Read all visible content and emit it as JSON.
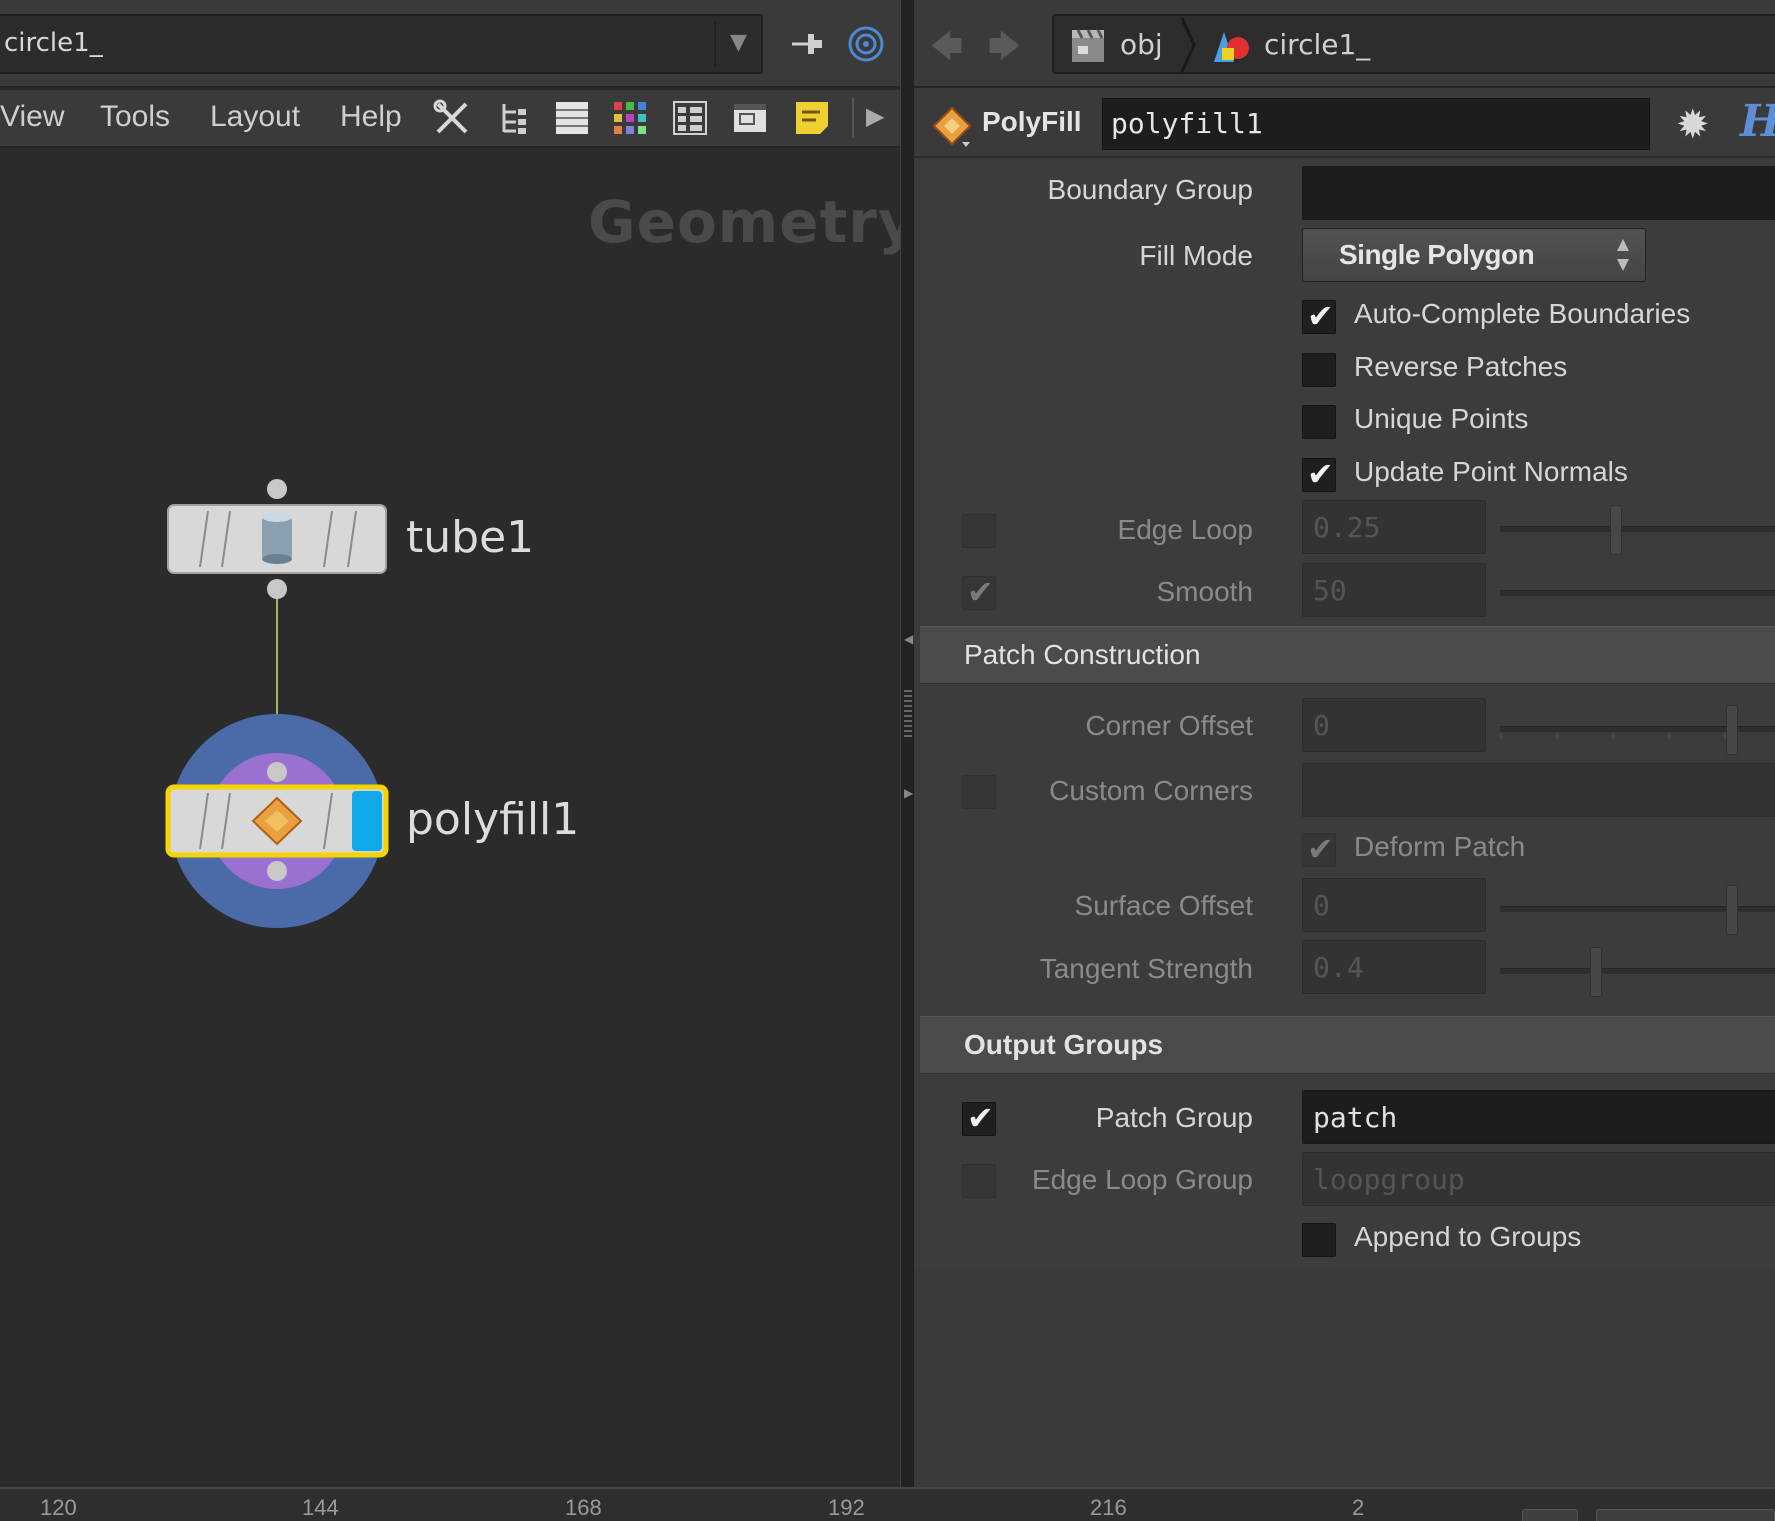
{
  "left_pane": {
    "path": "circle1_",
    "menu": [
      "View",
      "Tools",
      "Layout",
      "Help"
    ],
    "context_label": "Geometry",
    "nodes": [
      {
        "name": "tube1"
      },
      {
        "name": "polyfill1"
      }
    ]
  },
  "right_pane": {
    "breadcrumbs": [
      "obj",
      "circle1_"
    ],
    "operator": {
      "type": "PolyFill",
      "name": "polyfill1"
    },
    "params": {
      "boundary_group": {
        "label": "Boundary Group",
        "value": ""
      },
      "fill_mode": {
        "label": "Fill Mode",
        "value": "Single Polygon"
      },
      "auto_complete": {
        "label": "Auto-Complete Boundaries",
        "checked": true
      },
      "reverse_patches": {
        "label": "Reverse Patches",
        "checked": false
      },
      "unique_points": {
        "label": "Unique Points",
        "checked": false
      },
      "update_normals": {
        "label": "Update Point Normals",
        "checked": true
      },
      "edge_loop": {
        "label": "Edge Loop",
        "value": "0.25",
        "enabled": false
      },
      "smooth": {
        "label": "Smooth",
        "value": "50",
        "enabled": false
      },
      "section_patch": "Patch Construction",
      "corner_offset": {
        "label": "Corner Offset",
        "value": "0"
      },
      "custom_corners": {
        "label": "Custom Corners",
        "value": ""
      },
      "deform_patch": {
        "label": "Deform Patch",
        "checked": true
      },
      "surface_offset": {
        "label": "Surface Offset",
        "value": "0"
      },
      "tangent_strength": {
        "label": "Tangent Strength",
        "value": "0.4"
      },
      "section_output": "Output Groups",
      "patch_group": {
        "label": "Patch Group",
        "value": "patch",
        "checked": true
      },
      "edge_loop_group": {
        "label": "Edge Loop Group",
        "value": "loopgroup",
        "checked": false
      },
      "append_groups": {
        "label": "Append to Groups",
        "checked": false
      }
    }
  },
  "timeline": {
    "ticks": [
      "120",
      "144",
      "168",
      "192",
      "216",
      "2"
    ]
  },
  "colors": {
    "selection": "#f5d400",
    "display_flag": "#10a8e8",
    "node_ring_outer": "#4a6ba8",
    "node_ring_inner": "#9a70d0"
  }
}
